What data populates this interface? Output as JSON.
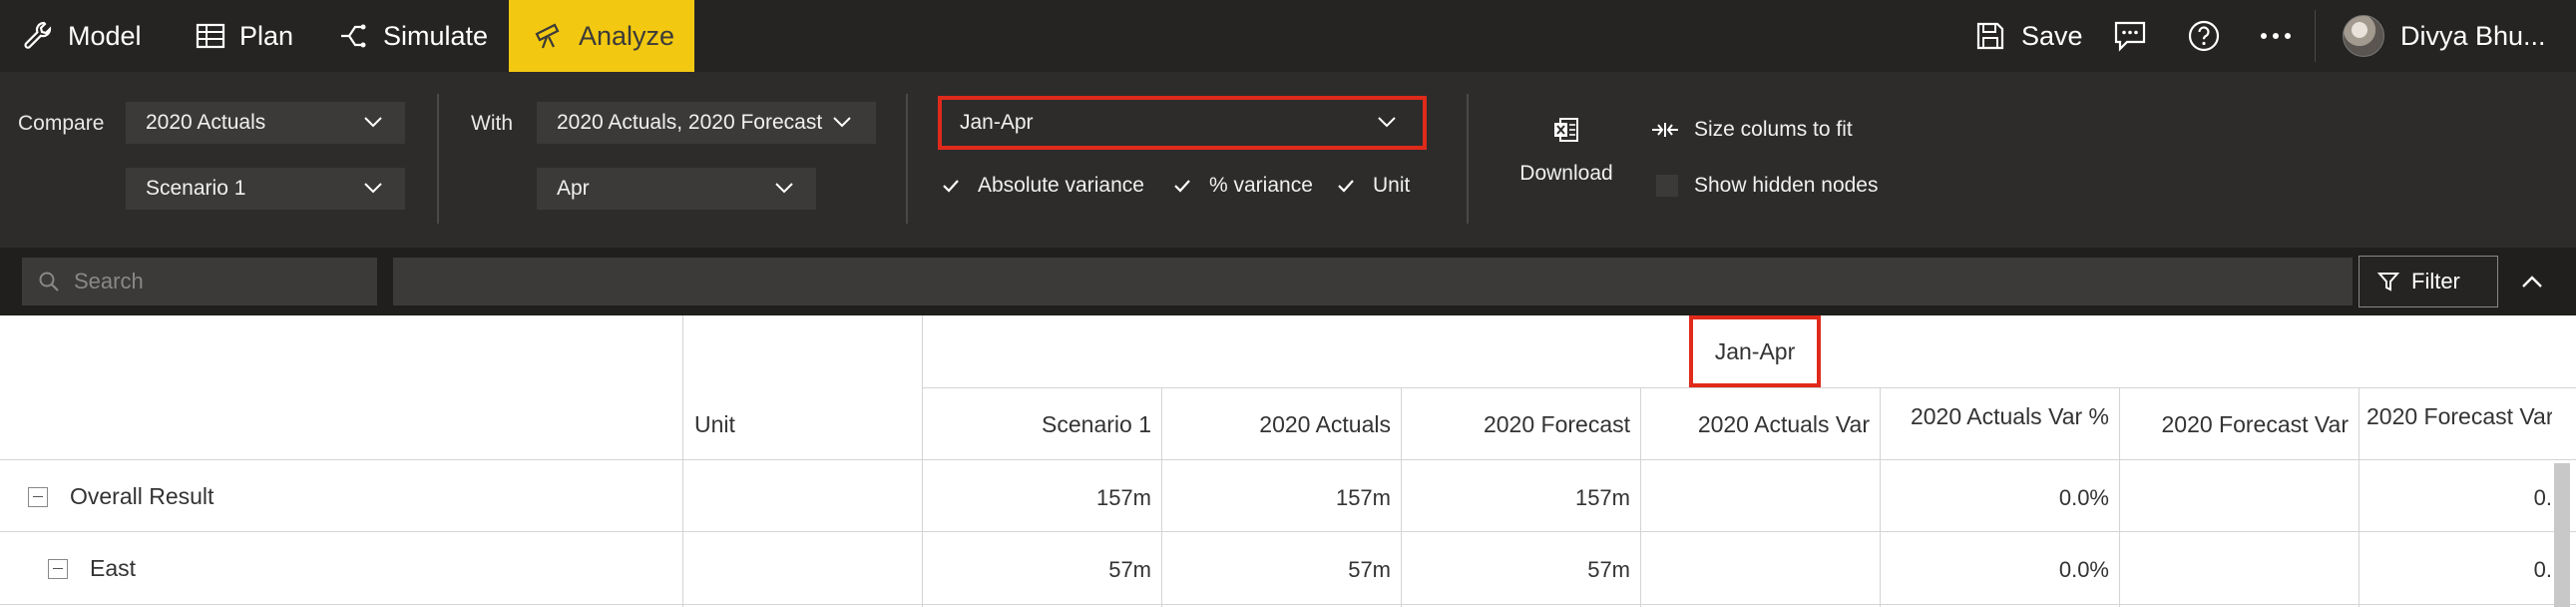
{
  "topbar": {
    "tabs": [
      {
        "label": "Model",
        "icon": "wrench-icon"
      },
      {
        "label": "Plan",
        "icon": "table-icon"
      },
      {
        "label": "Simulate",
        "icon": "branch-icon"
      },
      {
        "label": "Analyze",
        "icon": "telescope-icon",
        "active": true
      }
    ],
    "save_label": "Save",
    "comment_icon": "comment-icon",
    "help_icon": "help-icon",
    "more_icon": "more-icon",
    "user_name": "Divya Bhu..."
  },
  "ribbon": {
    "compare_label": "Compare",
    "compare_value": "2020 Actuals",
    "compare_value_2": "Scenario 1",
    "with_label": "With",
    "with_value": "2020 Actuals, 2020 Forecast",
    "with_value_2": "Apr",
    "period_value": "Jan-Apr",
    "absolute_variance_label": "Absolute variance",
    "absolute_variance_checked": true,
    "percent_variance_label": "% variance",
    "percent_variance_checked": true,
    "unit_label": "Unit",
    "unit_checked": true,
    "download_label": "Download",
    "size_columns_label": "Size colums to fit",
    "show_hidden_label": "Show hidden nodes",
    "show_hidden_checked": false
  },
  "searchbar": {
    "placeholder": "Search",
    "filter_label": "Filter"
  },
  "grid": {
    "period_header": "Jan-Apr",
    "unit_header": "Unit",
    "columns": [
      "Scenario 1",
      "2020 Actuals",
      "2020 Forecast",
      "2020 Actuals Var",
      "2020 Actuals Var %",
      "2020 Forecast Var",
      "2020 Forecast Var..."
    ],
    "rows": [
      {
        "label": "Overall Result",
        "cells": [
          "157m",
          "157m",
          "157m",
          "",
          "0.0%",
          "",
          "0."
        ]
      },
      {
        "label": "East",
        "cells": [
          "57m",
          "57m",
          "57m",
          "",
          "0.0%",
          "",
          "0."
        ]
      }
    ]
  },
  "colors": {
    "topbar_bg": "#252423",
    "ribbon_bg": "#2d2c2b",
    "active_tab": "#f2c811",
    "highlight_outline": "#e02a1a"
  }
}
